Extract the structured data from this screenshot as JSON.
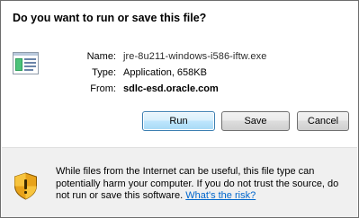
{
  "dialog": {
    "title": "Do you want to run or save this file?"
  },
  "file_info": {
    "icon": "installer-icon",
    "name_label": "Name:",
    "name_value": "jre-8u211-windows-i586-iftw.exe",
    "type_label": "Type:",
    "type_value": "Application, 658KB",
    "from_label": "From:",
    "from_value": "sdlc-esd.oracle.com"
  },
  "buttons": {
    "run_label": "Run",
    "save_label": "Save",
    "cancel_label": "Cancel"
  },
  "warning": {
    "icon": "security-shield-icon",
    "text": "While files from the Internet can be useful, this file type can potentially harm your computer. If you do not trust the source, do not run or save this software. ",
    "link_text": "What's the risk?"
  },
  "colors": {
    "link": "#0066cc",
    "run_button_border": "#3c7fb1",
    "panel_background": "#f0f0f0"
  }
}
